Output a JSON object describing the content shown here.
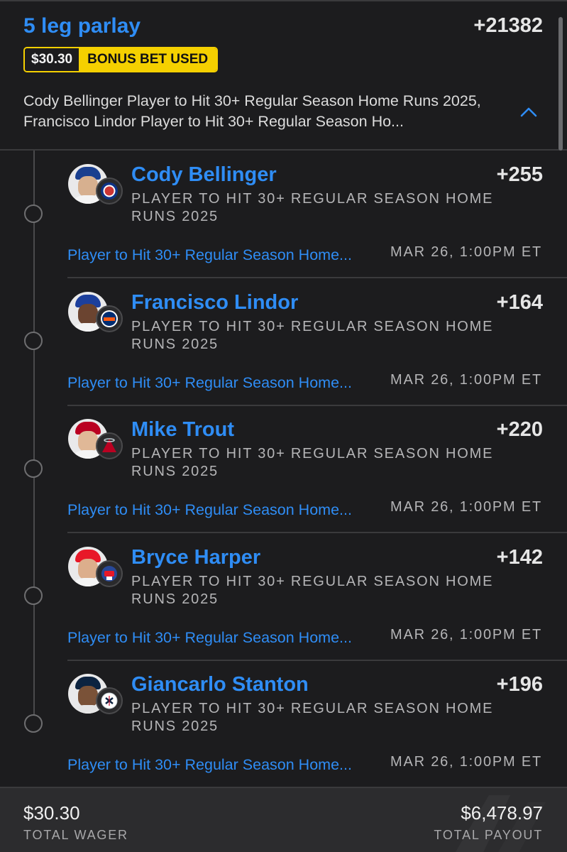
{
  "parlay": {
    "title": "5 leg parlay",
    "odds": "+21382",
    "bonus_amount": "$30.30",
    "bonus_label": "BONUS BET USED",
    "summary": "Cody Bellinger Player to Hit 30+ Regular Season Home Runs 2025, Francisco Lindor Player to Hit 30+ Regular Season Ho...",
    "expanded": true
  },
  "legs": [
    {
      "player": "Cody Bellinger",
      "odds": "+255",
      "market": "PLAYER TO HIT 30+ REGULAR SEASON HOME RUNS 2025",
      "link": "Player to Hit 30+ Regular Season Home...",
      "time": "MAR 26, 1:00PM ET",
      "team_icon": "cubs-logo-icon"
    },
    {
      "player": "Francisco Lindor",
      "odds": "+164",
      "market": "PLAYER TO HIT 30+ REGULAR SEASON HOME RUNS 2025",
      "link": "Player to Hit 30+ Regular Season Home...",
      "time": "MAR 26, 1:00PM ET",
      "team_icon": "mets-logo-icon"
    },
    {
      "player": "Mike Trout",
      "odds": "+220",
      "market": "PLAYER TO HIT 30+ REGULAR SEASON HOME RUNS 2025",
      "link": "Player to Hit 30+ Regular Season Home...",
      "time": "MAR 26, 1:00PM ET",
      "team_icon": "angels-logo-icon"
    },
    {
      "player": "Bryce Harper",
      "odds": "+142",
      "market": "PLAYER TO HIT 30+ REGULAR SEASON HOME RUNS 2025",
      "link": "Player to Hit 30+ Regular Season Home...",
      "time": "MAR 26, 1:00PM ET",
      "team_icon": "phillies-logo-icon"
    },
    {
      "player": "Giancarlo Stanton",
      "odds": "+196",
      "market": "PLAYER TO HIT 30+ REGULAR SEASON HOME RUNS 2025",
      "link": "Player to Hit 30+ Regular Season Home...",
      "time": "MAR 26, 1:00PM ET",
      "team_icon": "yankees-logo-icon"
    }
  ],
  "footer": {
    "wager_amount": "$30.30",
    "wager_label": "TOTAL WAGER",
    "payout_amount": "$6,478.97",
    "payout_label": "TOTAL PAYOUT"
  },
  "colors": {
    "accent": "#2f8df5",
    "background": "#1c1c1e",
    "bonus": "#f5d000",
    "footer": "#2c2c2e"
  }
}
